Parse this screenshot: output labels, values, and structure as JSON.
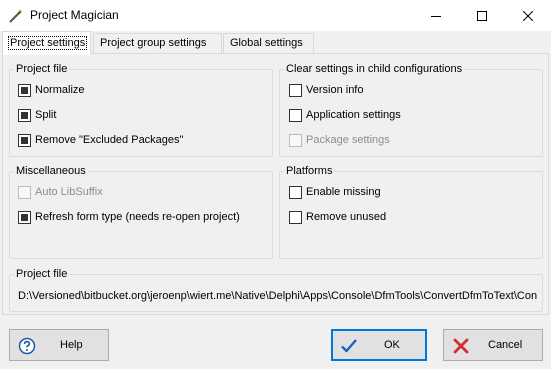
{
  "window": {
    "title": "Project Magician",
    "controls": {
      "minimize": "minimize",
      "maximize": "maximize",
      "close": "close"
    }
  },
  "tabs": [
    {
      "label": "Project settings",
      "active": true
    },
    {
      "label": "Project group settings",
      "active": false
    },
    {
      "label": "Global settings",
      "active": false
    }
  ],
  "project_file_group": {
    "title": "Project file",
    "options": [
      {
        "label": "Normalize",
        "checked": true,
        "enabled": true
      },
      {
        "label": "Split",
        "checked": true,
        "enabled": true
      },
      {
        "label": "Remove \"Excluded Packages\"",
        "checked": true,
        "enabled": true
      }
    ]
  },
  "clear_settings_group": {
    "title": "Clear settings in child configurations",
    "options": [
      {
        "label": "Version info",
        "checked": false,
        "enabled": true
      },
      {
        "label": "Application settings",
        "checked": false,
        "enabled": true
      },
      {
        "label": "Package settings",
        "checked": false,
        "enabled": false
      }
    ]
  },
  "misc_group": {
    "title": "Miscellaneous",
    "options": [
      {
        "label": "Auto LibSuffix",
        "checked": false,
        "enabled": false
      },
      {
        "label": "Refresh form type (needs re-open project)",
        "checked": true,
        "enabled": true
      }
    ]
  },
  "platforms_group": {
    "title": "Platforms",
    "options": [
      {
        "label": "Enable missing",
        "checked": false,
        "enabled": true
      },
      {
        "label": "Remove unused",
        "checked": false,
        "enabled": true
      }
    ]
  },
  "project_path_group": {
    "title": "Project file",
    "path": "D:\\Versioned\\bitbucket.org\\jeroenp\\wiert.me\\Native\\Delphi\\Apps\\Console\\DfmTools\\ConvertDfmToText\\Con"
  },
  "buttons": {
    "help": {
      "label": "Help",
      "icon": "question-icon"
    },
    "ok": {
      "label": "OK",
      "icon": "checkmark-icon"
    },
    "cancel": {
      "label": "Cancel",
      "icon": "red-x-icon"
    }
  },
  "colors": {
    "accent": "#0078d7",
    "checkmark": "#1565c0",
    "cancel_x": "#d32f2f"
  }
}
